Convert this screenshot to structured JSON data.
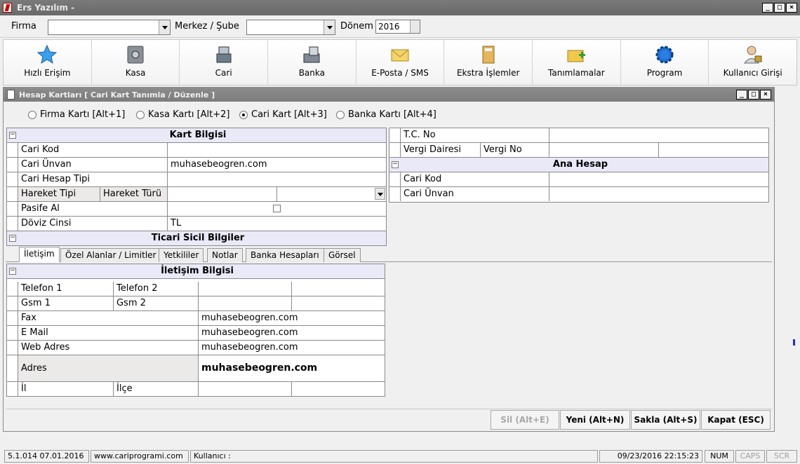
{
  "app": {
    "title": "Ers Yazılım  -"
  },
  "window_buttons": {
    "minimize": "_",
    "restore": "□",
    "close": "×"
  },
  "filter": {
    "firma_label": "Firma",
    "firma_value": "",
    "merkez_label": "Merkez / Şube",
    "merkez_value": "",
    "donem_label": "Dönem",
    "donem_value": "2016"
  },
  "toolbar": [
    {
      "label": "Hızlı Erişim",
      "icon": "star-icon"
    },
    {
      "label": "Kasa",
      "icon": "safe-icon"
    },
    {
      "label": "Cari",
      "icon": "cash-register-icon"
    },
    {
      "label": "Banka",
      "icon": "bank-icon"
    },
    {
      "label": "E-Posta  / SMS",
      "icon": "mail-icon"
    },
    {
      "label": "Ekstra İşlemler",
      "icon": "binder-icon"
    },
    {
      "label": "Tanımlamalar",
      "icon": "folder-add-icon"
    },
    {
      "label": "Program",
      "icon": "gear-icon"
    },
    {
      "label": "Kullanıcı  Girişi",
      "icon": "user-lock-icon"
    }
  ],
  "child": {
    "title": "Hesap Kartları [ Cari Kart Tanımla / Düzenle ]",
    "radios": [
      {
        "label": "Firma Kartı [Alt+1]",
        "checked": false
      },
      {
        "label": "Kasa Kartı [Alt+2]",
        "checked": false
      },
      {
        "label": "Cari Kart [Alt+3]",
        "checked": true
      },
      {
        "label": "Banka Kartı [Alt+4]",
        "checked": false
      }
    ],
    "kart": {
      "header": "Kart Bilgisi",
      "cari_kod_label": "Cari Kod",
      "cari_kod_value": "",
      "cari_unvan_label": "Cari Ünvan",
      "cari_unvan_value": "muhasebeogren.com",
      "hesap_tipi_label": "Cari Hesap Tipi",
      "hareket_tipi_label": "Hareket Tipi",
      "hareket_turu_label": "Hareket Türü",
      "pasife_label": "Pasife Al",
      "doviz_label": "Döviz Cinsi",
      "doviz_value": "TL",
      "ticari_header": "Ticari Sicil Bilgiler"
    },
    "right": {
      "tc_label": "T.C. No",
      "vergi_dairesi_label": "Vergi Dairesi",
      "vergi_no_label": "Vergi No",
      "ana_header": "Ana Hesap",
      "cari_kod_label": "Cari Kod",
      "cari_unvan_label": "Cari Ünvan"
    },
    "tabs": [
      "İletişim",
      "Özel Alanlar / Limitler",
      "Yetkililer",
      "Notlar",
      "Banka Hesapları",
      "Görsel"
    ],
    "iletisim": {
      "header": "İletişim Bilgisi",
      "telefon1": "Telefon 1",
      "telefon2": "Telefon 2",
      "gsm1": "Gsm 1",
      "gsm2": "Gsm 2",
      "fax_label": "Fax",
      "fax_value": "muhasebeogren.com",
      "email_label": "E Mail",
      "email_value": "muhasebeogren.com",
      "web_label": "Web Adres",
      "web_value": "muhasebeogren.com",
      "adres_label": "Adres",
      "adres_value": "muhasebeogren.com",
      "il_label": "İl",
      "ilce_label": "İlçe"
    },
    "buttons": {
      "sil": "Sil (Alt+E)",
      "yeni": "Yeni (Alt+N)",
      "sakla": "Sakla (Alt+S)",
      "kapat": "Kapat (ESC)"
    }
  },
  "status": {
    "version": "5.1.014 07.01.2016",
    "website": "www.cariprogrami.com",
    "user": "Kullanıcı :",
    "datetime": "09/23/2016 22:15:23",
    "num": "NUM",
    "caps": "CAPS",
    "scr": "SCR"
  }
}
